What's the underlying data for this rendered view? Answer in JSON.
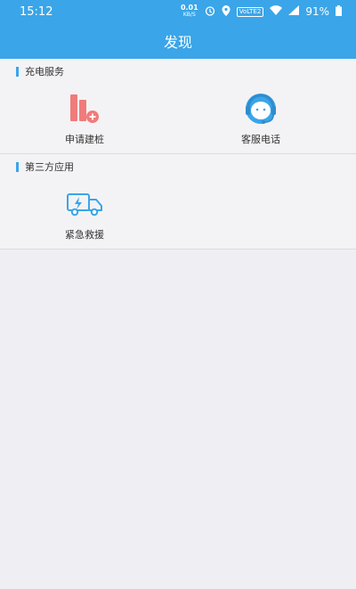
{
  "status_bar": {
    "time": "15:12",
    "net_speed_value": "0.01",
    "net_speed_unit": "KB/S",
    "volte_badge": "VoLTE2",
    "battery_percent": "91%",
    "icons": [
      "alarm-icon",
      "location-icon",
      "wifi-icon",
      "signal-icon",
      "battery-icon"
    ]
  },
  "app_bar": {
    "title": "发现"
  },
  "sections": [
    {
      "title": "充电服务",
      "items": [
        {
          "label": "申请建桩",
          "icon": "charging-pile-add-icon"
        },
        {
          "label": "客服电话",
          "icon": "customer-service-headset-icon"
        }
      ]
    },
    {
      "title": "第三方应用",
      "items": [
        {
          "label": "紧急救援",
          "icon": "rescue-truck-icon"
        }
      ]
    }
  ],
  "colors": {
    "primary": "#3aa5e8",
    "charging_icon": "#f07b7b",
    "background": "#efeef3"
  }
}
